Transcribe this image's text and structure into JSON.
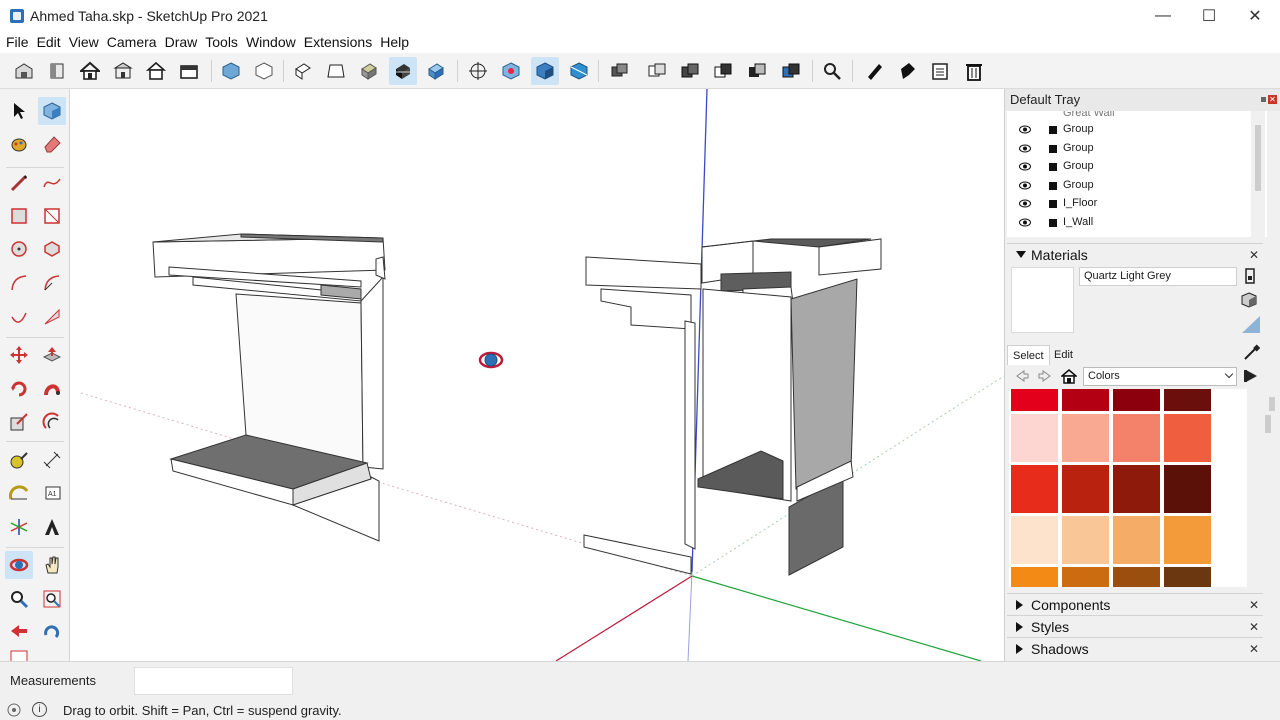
{
  "window": {
    "title": "Ahmed Taha.skp - SketchUp Pro 2021",
    "minimize": "—",
    "maximize": "☐",
    "close": "✕"
  },
  "menu": [
    "File",
    "Edit",
    "View",
    "Camera",
    "Draw",
    "Tools",
    "Window",
    "Extensions",
    "Help"
  ],
  "tray": {
    "title": "Default Tray",
    "outliner": {
      "partial_item": "Great Wall",
      "items": [
        "Group",
        "Group",
        "Group",
        "Group",
        "I_Floor",
        "I_Wall"
      ]
    },
    "materials": {
      "header": "Materials",
      "name_value": "Quartz Light Grey",
      "tabs": [
        "Select",
        "Edit"
      ],
      "library": "Colors",
      "swatch_colors": [
        [
          "#e3001b",
          "#b30012",
          "#8c000d",
          "#6a0f0c"
        ],
        [
          "#fdd6d2",
          "#f9a892",
          "#f4826a",
          "#ef5e3e"
        ],
        [
          "#e72c1b",
          "#b9220f",
          "#8d1a0b",
          "#5c1108"
        ],
        [
          "#fde2cc",
          "#f9c797",
          "#f5ac66",
          "#f39a3a"
        ],
        [
          "#f28a15",
          "#cb6c10",
          "#9b4f0e",
          "#6a3710"
        ]
      ]
    },
    "collapsed_sections": [
      "Components",
      "Styles",
      "Shadows"
    ],
    "close_glyph": "✕"
  },
  "statusbar": {
    "measurements_label": "Measurements",
    "measurements_value": "",
    "status_text": "Drag to orbit. Shift = Pan, Ctrl = suspend gravity.",
    "info_icon": "i"
  },
  "icons": {
    "toolbar": [
      "warehouse-icon",
      "component-icon",
      "home-icon",
      "front-view-icon",
      "back-view-icon",
      "right-view-icon",
      "material-cube-icon",
      "eraser-icon",
      "top-view-icon",
      "iso-view-icon",
      "left-view-icon",
      "bottom-view-icon",
      "xray-style-icon",
      "monochrome-style-icon",
      "shaded-style-icon",
      "position-camera-icon",
      "section-plane-icon",
      "section-display-icon",
      "section-cut-icon",
      "outer-shell-icon",
      "intersect-icon",
      "union-icon",
      "subtract-icon",
      "trim-icon",
      "split-icon",
      "zoom-extents-icon",
      "pen-icon",
      "paint-icon",
      "generate-report-icon",
      "trash-icon"
    ],
    "left": [
      "select-icon",
      "component-icon",
      "paint-bucket-icon",
      "eraser-icon",
      "line-icon",
      "freehand-icon",
      "rectangle-icon",
      "rotated-rectangle-icon",
      "circle-icon",
      "polygon-icon",
      "arc-icon",
      "pie-icon",
      "two-point-arc-icon",
      "three-point-arc-icon",
      "move-icon",
      "push-pull-icon",
      "rotate-icon",
      "follow-me-icon",
      "scale-icon",
      "offset-icon",
      "tape-measure-icon",
      "dimension-icon",
      "protractor-icon",
      "text-icon",
      "axes-icon",
      "3d-text-icon",
      "orbit-icon",
      "pan-icon",
      "zoom-icon",
      "zoom-window-icon",
      "previous-view-icon",
      "next-view-icon",
      "walk-icon"
    ]
  }
}
